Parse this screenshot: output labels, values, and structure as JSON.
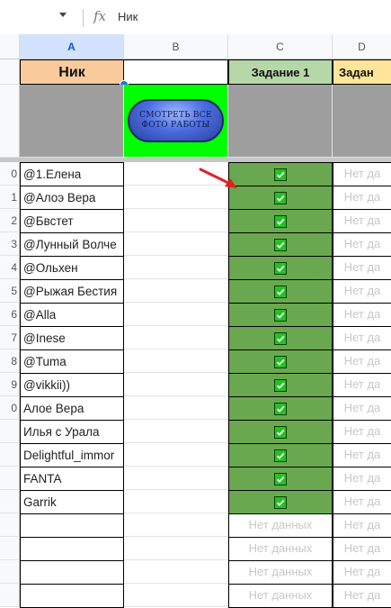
{
  "formula_bar": {
    "fx_label": "fx",
    "value": "Ник"
  },
  "columns": [
    "A",
    "B",
    "C",
    "D"
  ],
  "row_numbers": [
    "",
    "",
    "",
    "",
    "",
    "",
    "",
    "0",
    "1",
    "2",
    "3",
    "4",
    "5",
    "6",
    "7",
    "8",
    "9",
    "0"
  ],
  "header": {
    "nick": "Ник",
    "task1": "Задание 1",
    "task2": "Задан"
  },
  "photo_button": {
    "line1": "СМОТРЕТЬ ВСЕ",
    "line2": "ФОТО РАБОТЫ"
  },
  "nodata_text": "Нет данных",
  "nodata_text_partial": "Нет да",
  "rows": [
    {
      "nick": "@1.Елена",
      "checked": true
    },
    {
      "nick": "@Алоэ Вера",
      "checked": true
    },
    {
      "nick": "@Бвстет",
      "checked": true
    },
    {
      "nick": "@Лунный Волче",
      "checked": true
    },
    {
      "nick": "@Ольхен",
      "checked": true
    },
    {
      "nick": "@Рыжая Бестия",
      "checked": true
    },
    {
      "nick": "@Alla",
      "checked": true
    },
    {
      "nick": "@Inese",
      "checked": true
    },
    {
      "nick": "@Tuma",
      "checked": true
    },
    {
      "nick": "@vikkii))",
      "checked": true
    },
    {
      "nick": "Алое Вера",
      "checked": true
    },
    {
      "nick": "Илья с Урала",
      "checked": true
    },
    {
      "nick": "Delightful_immor",
      "checked": true
    },
    {
      "nick": "FANTA",
      "checked": true
    },
    {
      "nick": "Garrik",
      "checked": true
    },
    {
      "nick": "",
      "checked": false
    },
    {
      "nick": "",
      "checked": false
    },
    {
      "nick": "",
      "checked": false
    },
    {
      "nick": "",
      "checked": false
    }
  ],
  "colors": {
    "check_green": "#6aa84f",
    "nick_header": "#f9cb9c",
    "task_header": "#b6d7a8",
    "task2_header": "#ffe599",
    "button_bg": "#00ff00",
    "arrow": "#e02020"
  }
}
